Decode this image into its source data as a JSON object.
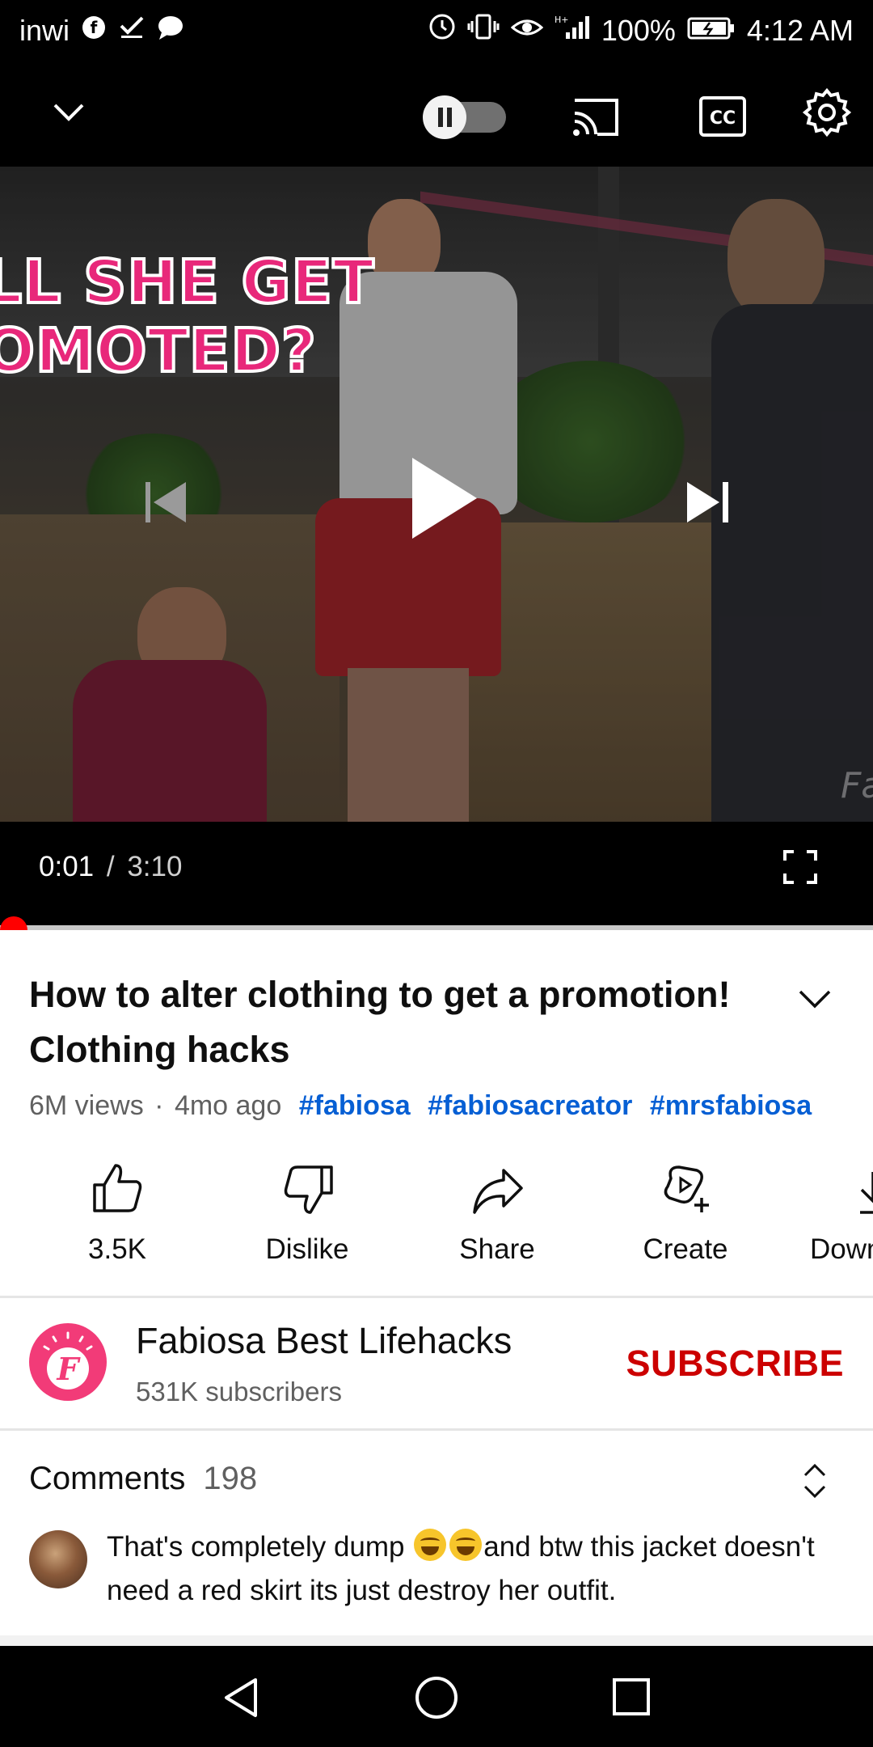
{
  "status_bar": {
    "carrier": "inwi",
    "battery": "100%",
    "time": "4:12 AM"
  },
  "player": {
    "current_time": "0:01",
    "separator": "/",
    "duration": "3:10",
    "progress_fraction": 0.005,
    "autoplay": "on",
    "thumbnail_text": {
      "line1": "LL SHE GET",
      "line2": "OMOTED?",
      "watermark": "Fa"
    }
  },
  "video": {
    "title": "How to alter clothing to get a promotion! Clothing hacks",
    "views": "6M views",
    "dot": "·",
    "age": "4mo ago",
    "hashtags": [
      "#fabiosa",
      "#fabiosacreator",
      "#mrsfabiosa"
    ]
  },
  "actions": [
    {
      "label": "3.5K",
      "icon": "thumb-up-icon"
    },
    {
      "label": "Dislike",
      "icon": "thumb-down-icon"
    },
    {
      "label": "Share",
      "icon": "share-icon"
    },
    {
      "label": "Create",
      "icon": "create-icon"
    },
    {
      "label": "Down",
      "icon": "download-icon"
    }
  ],
  "channel": {
    "name": "Fabiosa Best Lifehacks",
    "subscribers": "531K subscribers",
    "subscribe_label": "SUBSCRIBE",
    "logo_letter": "F",
    "brand_color": "#f23b78"
  },
  "comments": {
    "title": "Comments",
    "count": "198",
    "first": {
      "text_before": "That's completely dump",
      "text_after": "and btw this jacket doesn't need a red skirt its just destroy her outfit."
    }
  },
  "colors": {
    "accent_red": "#ff0000",
    "subscribe_red": "#cc0000",
    "hashtag_blue": "#065fd4"
  }
}
